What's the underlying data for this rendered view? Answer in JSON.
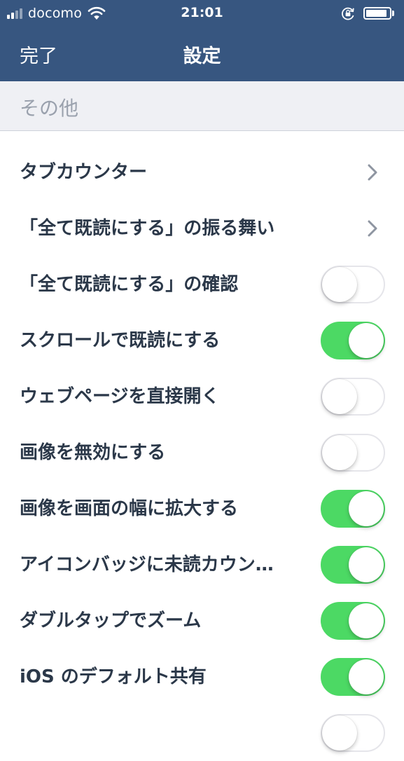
{
  "status_bar": {
    "carrier": "docomo",
    "time": "21:01",
    "battery_level": 0.9
  },
  "nav": {
    "done_label": "完了",
    "title": "設定"
  },
  "section": {
    "header": "その他"
  },
  "settings": [
    {
      "label": "タブカウンター",
      "control": "chevron"
    },
    {
      "label": "「全て既読にする」の振る舞い",
      "control": "chevron"
    },
    {
      "label": "「全て既読にする」の確認",
      "control": "toggle",
      "on": false
    },
    {
      "label": "スクロールで既読にする",
      "control": "toggle",
      "on": true
    },
    {
      "label": "ウェブページを直接開く",
      "control": "toggle",
      "on": false
    },
    {
      "label": "画像を無効にする",
      "control": "toggle",
      "on": false
    },
    {
      "label": "画像を画面の幅に拡大する",
      "control": "toggle",
      "on": true
    },
    {
      "label": "アイコンバッジに未読カウン…",
      "control": "toggle",
      "on": true
    },
    {
      "label": "ダブルタップでズーム",
      "control": "toggle",
      "on": true
    },
    {
      "label": "iOS のデフォルト共有",
      "control": "toggle",
      "on": true
    },
    {
      "label": "",
      "control": "toggle",
      "on": false
    }
  ],
  "colors": {
    "nav_background": "#375680",
    "toggle_on": "#4cd964",
    "label_text": "#2b3849",
    "section_text": "#9aa1ad"
  }
}
